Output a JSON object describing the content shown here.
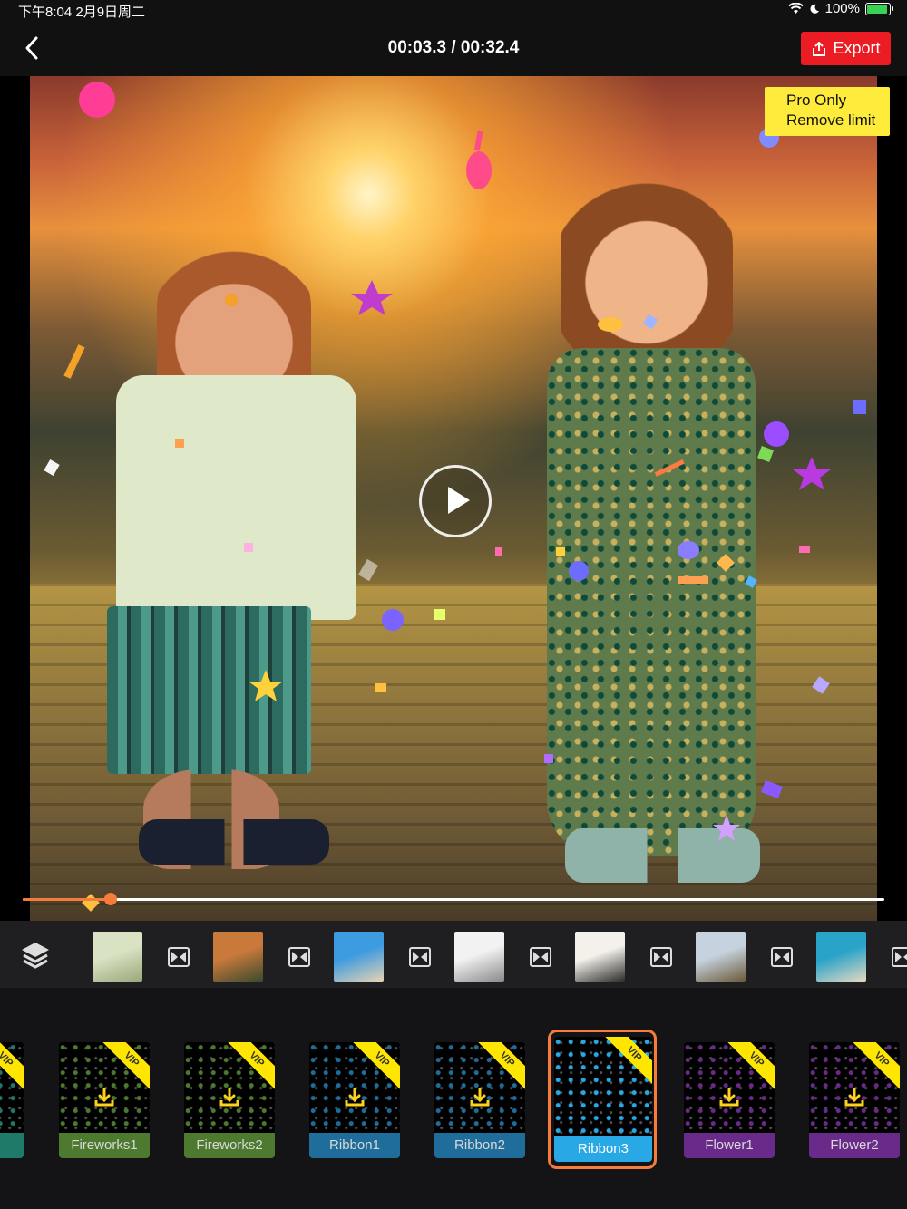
{
  "status_bar": {
    "time_date": "下午8:04   2月9日周二",
    "battery": "100%",
    "battery_level": 1.0
  },
  "nav": {
    "timecode": "00:03.3 / 00:32.4",
    "export_label": "Export",
    "accent_color": "#ec1c24"
  },
  "preview": {
    "pro_badge_line1": "Pro Only",
    "pro_badge_line2": "Remove limit",
    "progress": 0.102,
    "progress_color": "#f57c3a"
  },
  "clips": {
    "count_visible": 9,
    "thumbnails": [
      {
        "name": "clip-1",
        "colors": [
          "#d9e2c3",
          "#9aa77a"
        ]
      },
      {
        "name": "clip-2",
        "colors": [
          "#c97a3a",
          "#3b4a30"
        ]
      },
      {
        "name": "clip-3",
        "colors": [
          "#3d9be0",
          "#e7d2b3"
        ]
      },
      {
        "name": "clip-4",
        "colors": [
          "#f2f2f2",
          "#8a8a8a"
        ]
      },
      {
        "name": "clip-5",
        "colors": [
          "#f4f1ea",
          "#2b2b2b"
        ]
      },
      {
        "name": "clip-6",
        "colors": [
          "#c6d3de",
          "#6b5a3a"
        ]
      },
      {
        "name": "clip-7",
        "colors": [
          "#2aa3c9",
          "#e5d9c0"
        ]
      },
      {
        "name": "clip-8",
        "colors": [
          "#f2c58a",
          "#3a2c2a"
        ]
      },
      {
        "name": "clip-9",
        "colors": [
          "#d8d2cc",
          "#5a4a44"
        ]
      }
    ]
  },
  "effects": [
    {
      "label": "",
      "color": "#1f7a6a",
      "vip": true,
      "partial": true
    },
    {
      "label": "Fireworks1",
      "color": "#4e7a2f",
      "vip": true
    },
    {
      "label": "Fireworks2",
      "color": "#4e7a2f",
      "vip": true
    },
    {
      "label": "Ribbon1",
      "color": "#1f6d9a",
      "vip": true
    },
    {
      "label": "Ribbon2",
      "color": "#1f6d9a",
      "vip": true
    },
    {
      "label": "Ribbon3",
      "color": "#29a8e6",
      "vip": true,
      "selected": true
    },
    {
      "label": "Flower1",
      "color": "#6a2a8a",
      "vip": true
    },
    {
      "label": "Flower2",
      "color": "#6a2a8a",
      "vip": true
    }
  ],
  "vip_text": "VIP"
}
